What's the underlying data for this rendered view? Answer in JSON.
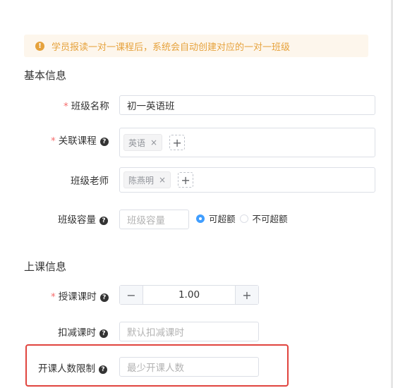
{
  "alert": {
    "icon": "warning-icon",
    "text": "学员报读一对一课程后，系统会自动创建对应的一对一班级"
  },
  "sections": {
    "basic": "基本信息",
    "class_info": "上课信息"
  },
  "fields": {
    "class_name": {
      "required_mark": "*",
      "label": "班级名称",
      "value": "初一英语班"
    },
    "course": {
      "required_mark": "*",
      "label": "关联课程",
      "tags": [
        "英语"
      ]
    },
    "teacher": {
      "label": "班级老师",
      "tags": [
        "陈燕明"
      ]
    },
    "capacity": {
      "label": "班级容量",
      "placeholder": "班级容量",
      "options": [
        "可超额",
        "不可超额"
      ],
      "selected": "可超额"
    },
    "class_hours": {
      "required_mark": "*",
      "label": "授课课时",
      "value": "1.00"
    },
    "deduct_hours": {
      "label": "扣减课时",
      "placeholder": "默认扣减课时"
    },
    "min_students": {
      "label": "开课人数限制",
      "placeholder": "最少开课人数"
    }
  },
  "glyphs": {
    "tag_close": "×",
    "add": "+",
    "minus": "−",
    "plus": "+",
    "help": "?",
    "warn": "!"
  },
  "colors": {
    "accent": "#409eff",
    "warning": "#e6a23c",
    "required": "#f56c6c",
    "highlight": "#e0443e"
  }
}
